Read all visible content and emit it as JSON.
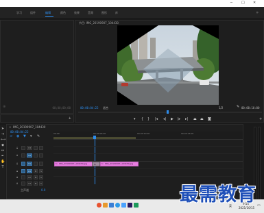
{
  "menubar": {
    "workspaces": [
      "学习",
      "组件",
      "编辑",
      "颜色",
      "效果",
      "音频",
      "图形",
      "库"
    ],
    "active_index": 2
  },
  "source_panel": {
    "timecode": "00;00;00;00"
  },
  "program": {
    "title": "节目: IMG_20190907_104430",
    "timecode_current": "00:00:04:22",
    "fit_label": "适合",
    "quality_label": "1/2",
    "timecode_duration": "00:00:10:00"
  },
  "timeline": {
    "tab_title": "IMG_20190907_104430",
    "timecode": "00:00:04:22",
    "ruler_labels": [
      "00:00",
      "00:00:05:00",
      "00:00:10:00",
      "00:00:15:00"
    ],
    "clips": [
      {
        "label": "IMG_20190907_104430.jpg"
      },
      {
        "label": "IMG_20190907_104430.jpg"
      }
    ],
    "transition_label": "fx",
    "tracks": [
      {
        "name": "V3"
      },
      {
        "name": "V2"
      },
      {
        "name": "V1"
      },
      {
        "name": "A1"
      },
      {
        "name": "A2"
      },
      {
        "name": "A3"
      }
    ],
    "master_label": "主声道",
    "master_value": "0.0"
  },
  "taskbar": {
    "time": "9:56",
    "date": "2021/10/15",
    "lang": "英"
  },
  "watermark": {
    "text": "最需教育"
  },
  "colors": {
    "accent": "#2d8ceb",
    "clip": "#e77ee0",
    "watermark": "#1e4fb8"
  }
}
